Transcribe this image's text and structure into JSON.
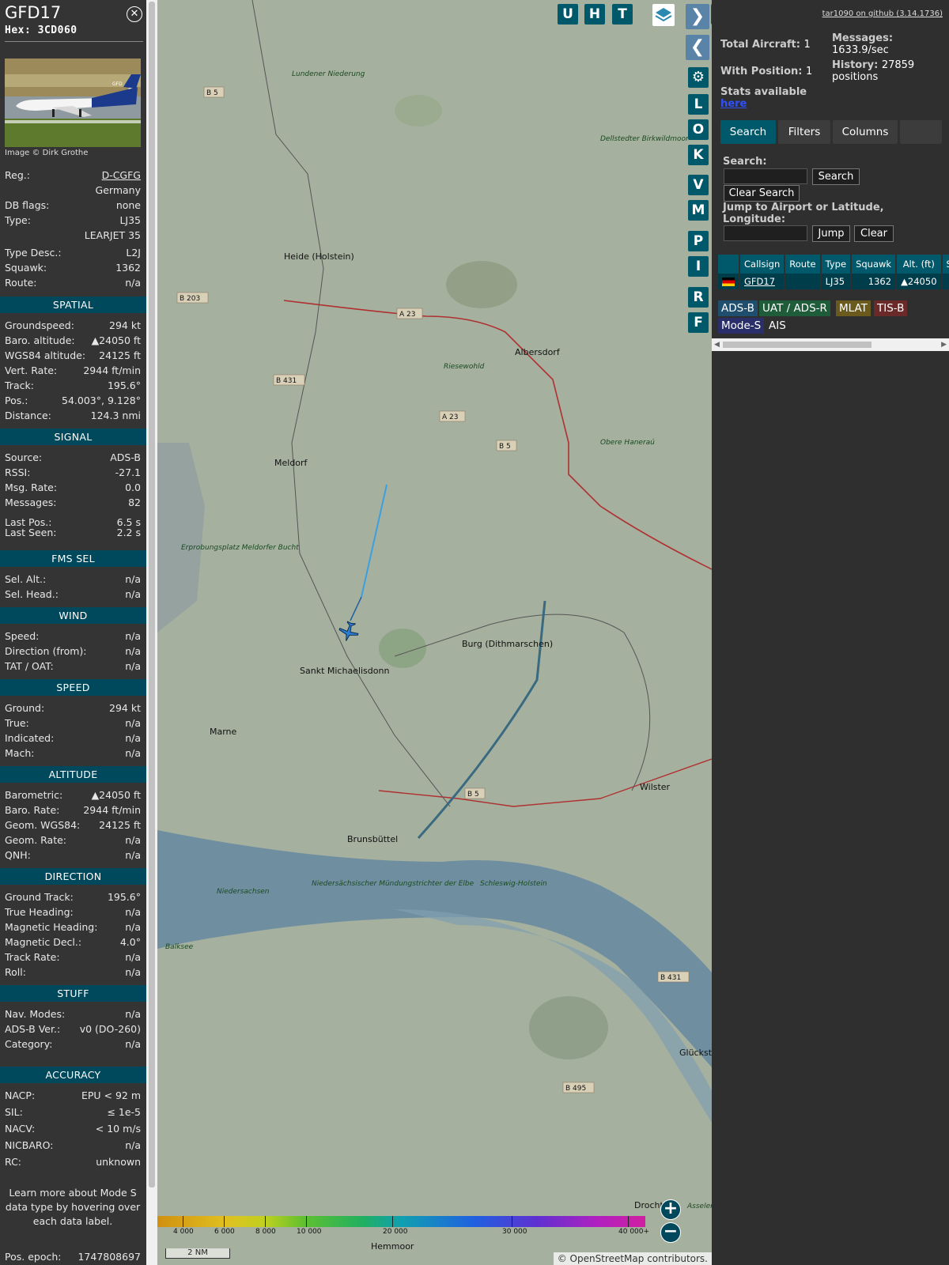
{
  "info": {
    "callsign": "GFD17",
    "hex": "Hex: 3CD060",
    "close_icon": "close-circle-icon",
    "photo_credit": "Image © Dirk Grothe",
    "details": [
      {
        "k": "Reg.:",
        "v": "D-CGFG"
      },
      {
        "k": "",
        "v": "Germany"
      },
      {
        "k": "DB flags:",
        "v": "none"
      },
      {
        "k": "Type:",
        "v": "LJ35"
      },
      {
        "k": "",
        "v": "LEARJET 35"
      },
      {
        "k": "Type Desc.:",
        "v": "L2J"
      },
      {
        "k": "Squawk:",
        "v": "1362"
      },
      {
        "k": "Route:",
        "v": "n/a"
      }
    ],
    "sections": [
      {
        "title": "SPATIAL",
        "rows": [
          {
            "k": "Groundspeed:",
            "v": "294 kt"
          },
          {
            "k": "Baro. altitude:",
            "v": "▲24050 ft"
          },
          {
            "k": "WGS84 altitude:",
            "v": "24125 ft"
          },
          {
            "k": "Vert. Rate:",
            "v": "2944 ft/min"
          },
          {
            "k": "Track:",
            "v": "195.6°"
          },
          {
            "k": "Pos.:",
            "v": "54.003°, 9.128°"
          },
          {
            "k": "Distance:",
            "v": "124.3 nmi"
          }
        ]
      },
      {
        "title": "SIGNAL",
        "rows": [
          {
            "k": "Source:",
            "v": "ADS-B"
          },
          {
            "k": "RSSI:",
            "v": "-27.1"
          },
          {
            "k": "Msg. Rate:",
            "v": "0.0"
          },
          {
            "k": "Messages:",
            "v": "82"
          },
          {
            "k": "Last Pos.:",
            "v": "6.5 s"
          },
          {
            "k": "Last Seen:",
            "v": "2.2 s"
          }
        ]
      },
      {
        "title": "FMS SEL",
        "rows": [
          {
            "k": "Sel. Alt.:",
            "v": "n/a"
          },
          {
            "k": "Sel. Head.:",
            "v": "n/a"
          }
        ]
      },
      {
        "title": "WIND",
        "rows": [
          {
            "k": "Speed:",
            "v": "n/a"
          },
          {
            "k": "Direction (from):",
            "v": "n/a"
          },
          {
            "k": "TAT / OAT:",
            "v": "n/a"
          }
        ]
      },
      {
        "title": "SPEED",
        "rows": [
          {
            "k": "Ground:",
            "v": "294 kt"
          },
          {
            "k": "True:",
            "v": "n/a"
          },
          {
            "k": "Indicated:",
            "v": "n/a"
          },
          {
            "k": "Mach:",
            "v": "n/a"
          }
        ]
      },
      {
        "title": "ALTITUDE",
        "rows": [
          {
            "k": "Barometric:",
            "v": "▲24050 ft"
          },
          {
            "k": "Baro. Rate:",
            "v": "2944 ft/min"
          },
          {
            "k": "Geom. WGS84:",
            "v": "24125 ft"
          },
          {
            "k": "Geom. Rate:",
            "v": "n/a"
          },
          {
            "k": "QNH:",
            "v": "n/a"
          }
        ]
      },
      {
        "title": "DIRECTION",
        "rows": [
          {
            "k": "Ground Track:",
            "v": "195.6°"
          },
          {
            "k": "True Heading:",
            "v": "n/a"
          },
          {
            "k": "Magnetic Heading:",
            "v": "n/a"
          },
          {
            "k": "Magnetic Decl.:",
            "v": "4.0°"
          },
          {
            "k": "Track Rate:",
            "v": "n/a"
          },
          {
            "k": "Roll:",
            "v": "n/a"
          }
        ]
      },
      {
        "title": "STUFF",
        "rows": [
          {
            "k": "Nav. Modes:",
            "v": "n/a"
          },
          {
            "k": "ADS-B Ver.:",
            "v": "v0 (DO-260)"
          },
          {
            "k": "Category:",
            "v": "n/a"
          }
        ]
      },
      {
        "title": "ACCURACY",
        "rows": [
          {
            "k": "NACP:",
            "v": "EPU < 92 m"
          },
          {
            "k": "SIL:",
            "v": "≤ 1e-5"
          },
          {
            "k": "NACV:",
            "v": "< 10 m/s"
          },
          {
            "k": "NICBARO:",
            "v": "n/a"
          },
          {
            "k": "RC:",
            "v": "unknown"
          }
        ]
      }
    ],
    "note": "Learn more about Mode S data type by hovering over each data label.",
    "epoch_label": "Pos. epoch:",
    "epoch_value": "1747808697"
  },
  "map": {
    "buttons_left": [
      "U",
      "H",
      "T"
    ],
    "buttons_col": [
      "L",
      "O",
      "K",
      "V",
      "M",
      "P",
      "I",
      "R",
      "F"
    ],
    "place_labels": [
      "Heide (Holstein)",
      "Albersdorf",
      "Meldorf",
      "Burg (Dithmarschen)",
      "Sankt Michaelisdonn",
      "Marne",
      "Brunsbüttel",
      "Wilster",
      "Hemmoor",
      "Drochter",
      "Glückstadt",
      "Lundener Niederung",
      "Dellstedter Birkwildmoor",
      "Riesewohld",
      "Obere Haneraú",
      "Erprobungsplatz Meldorfer Bucht",
      "Niedersächsischer Mündungstrichter der Elbe",
      "Schleswig-Holstein",
      "Niedersachsen",
      "Balksee",
      "Asseler"
    ],
    "road_labels": [
      "B 5",
      "B 203",
      "A 23",
      "B 431",
      "A 23",
      "B 5",
      "B 5",
      "B 431",
      "B 495"
    ],
    "altitude_scale": [
      "4 000",
      "6 000",
      "8 000",
      "10 000",
      "20 000",
      "30 000",
      "40 000+"
    ],
    "scale_bar": "2 NM",
    "attribution_prefix": "©",
    "attribution_link": "OpenStreetMap",
    "attribution_suffix": "contributors.",
    "zoom_in": "+",
    "zoom_out": "−"
  },
  "panel": {
    "github_link": "tar1090 on github (3.14.1736)",
    "total_label": "Total Aircraft:",
    "total_value": "1",
    "withpos_label": "With Position:",
    "withpos_value": "1",
    "stats_label": "Stats available",
    "stats_link": "here",
    "messages_label": "Messages:",
    "messages_value": "1633.9/sec",
    "history_label": "History:",
    "history_value": "27859 positions",
    "tabs": [
      "Search",
      "Filters",
      "Columns"
    ],
    "search_label": "Search:",
    "search_button": "Search",
    "clear_search_button": "Clear Search",
    "jump_label": "Jump to Airport or Latitude, Longitude:",
    "jump_button": "Jump",
    "clear_button": "Clear",
    "table_headers": [
      "",
      "Callsign",
      "Route",
      "Type",
      "Squawk",
      "Alt. (ft)",
      "Spd"
    ],
    "table_rows": [
      {
        "flag": "de-flag-icon",
        "callsign": "GFD17",
        "route": "",
        "type": "LJ35",
        "squawk": "1362",
        "alt": "▲24050",
        "spd": ""
      }
    ],
    "legend": [
      {
        "label": "ADS-B",
        "color": "#1f4e6e"
      },
      {
        "label": "UAT / ADS-R",
        "color": "#1e5c3a"
      },
      {
        "label": "MLAT",
        "color": "#6a5a1e"
      },
      {
        "label": "TIS-B",
        "color": "#6a2a2a"
      },
      {
        "label": "Mode-S",
        "color": "#2a2f6a"
      },
      {
        "label": "AIS",
        "color": "#2f2f2f"
      }
    ]
  },
  "colors": {
    "accent": "#00596b",
    "section": "#00485c",
    "track": "#3aa0e0",
    "aircraft": "#2a7fd0"
  }
}
